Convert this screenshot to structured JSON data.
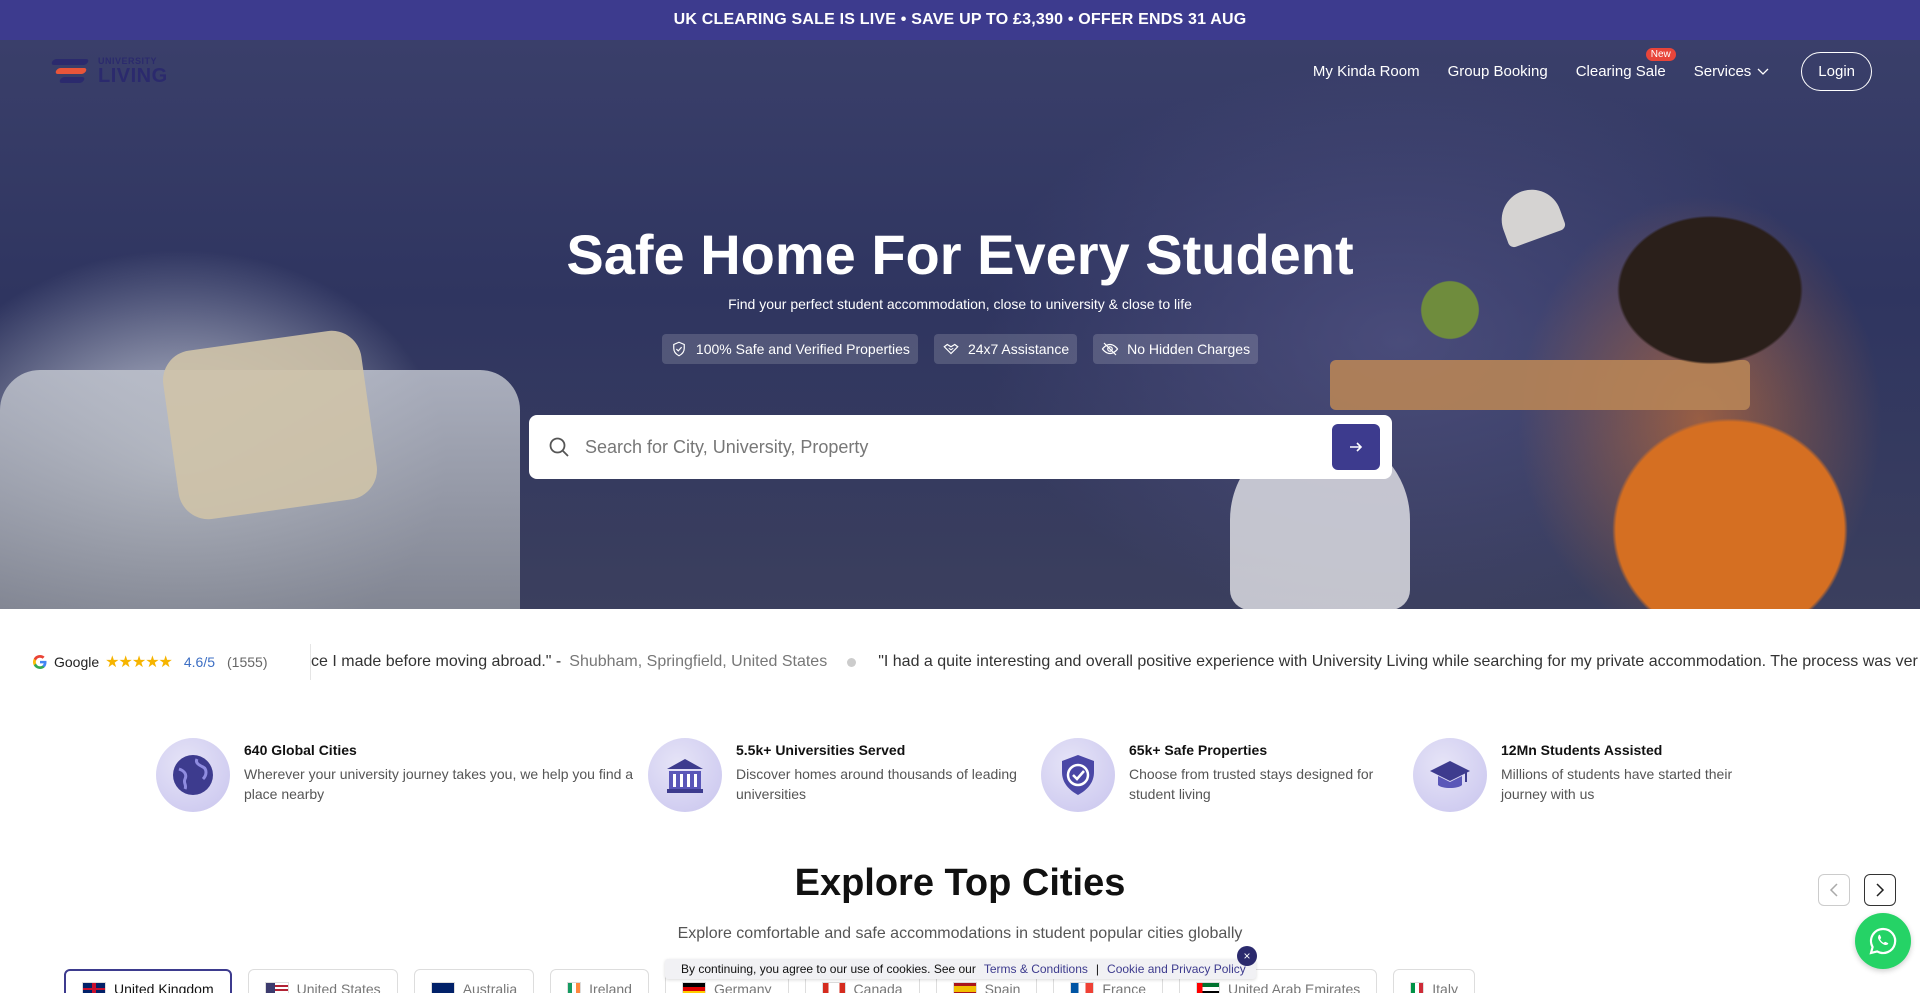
{
  "promo": {
    "text": "UK CLEARING SALE IS LIVE • SAVE UP TO £3,390 • OFFER ENDS 31 AUG"
  },
  "logo": {
    "line1": "UNIVERSITY",
    "line2": "LIVING"
  },
  "nav": {
    "items": [
      {
        "label": "My Kinda Room"
      },
      {
        "label": "Group Booking"
      },
      {
        "label": "Clearing Sale",
        "badge": "New"
      },
      {
        "label": "Services"
      }
    ],
    "login": "Login"
  },
  "hero": {
    "title": "Safe Home For Every Student",
    "subtitle": "Find your perfect student accommodation, close to university & close to life",
    "features": [
      {
        "label": "100% Safe and Verified Properties",
        "icon": "shield-check-icon"
      },
      {
        "label": "24x7 Assistance",
        "icon": "handshake-icon"
      },
      {
        "label": "No Hidden Charges",
        "icon": "eye-off-icon"
      }
    ],
    "search_placeholder": "Search for City, University, Property"
  },
  "reviews": {
    "source": "Google",
    "stars": "★★★★★",
    "score": "4.6/5",
    "count": "(1555)",
    "items": [
      {
        "text": "ce I made before moving abroad.\" -",
        "author": "Shubham, Springfield, United States"
      },
      {
        "text": "\"I had a quite interesting and overall positive experience with University Living while searching for my private accommodation. The process was ver",
        "author": ""
      }
    ]
  },
  "stats": [
    {
      "title": "640 Global Cities",
      "desc": "Wherever your university journey takes you, we help you find a place nearby",
      "icon": "globe-icon"
    },
    {
      "title": "5.5k+ Universities Served",
      "desc": "Discover homes around thousands of leading universities",
      "icon": "university-building-icon"
    },
    {
      "title": "65k+ Safe Properties",
      "desc": "Choose from trusted stays designed for student living",
      "icon": "shield-check-icon"
    },
    {
      "title": "12Mn Students Assisted",
      "desc": "Millions of students have started their journey with us",
      "icon": "graduation-cap-icon"
    }
  ],
  "explore": {
    "title": "Explore Top Cities",
    "subtitle": "Explore comfortable and safe accommodations in student popular cities globally",
    "countries": [
      {
        "label": "United Kingdom",
        "active": true
      },
      {
        "label": "United States"
      },
      {
        "label": "Australia"
      },
      {
        "label": "Ireland"
      },
      {
        "label": "Germany"
      },
      {
        "label": "Canada"
      },
      {
        "label": "Spain"
      },
      {
        "label": "France"
      },
      {
        "label": "United Arab Emirates"
      },
      {
        "label": "Italy"
      }
    ]
  },
  "cookie": {
    "text": "By continuing, you agree to our use of cookies. See our",
    "terms": "Terms & Conditions",
    "sep": "|",
    "policy": "Cookie and Privacy Policy",
    "close": "×"
  },
  "colors": {
    "brand": "#3d3b8e",
    "accent": "#e8453a",
    "whatsapp": "#25d366"
  }
}
